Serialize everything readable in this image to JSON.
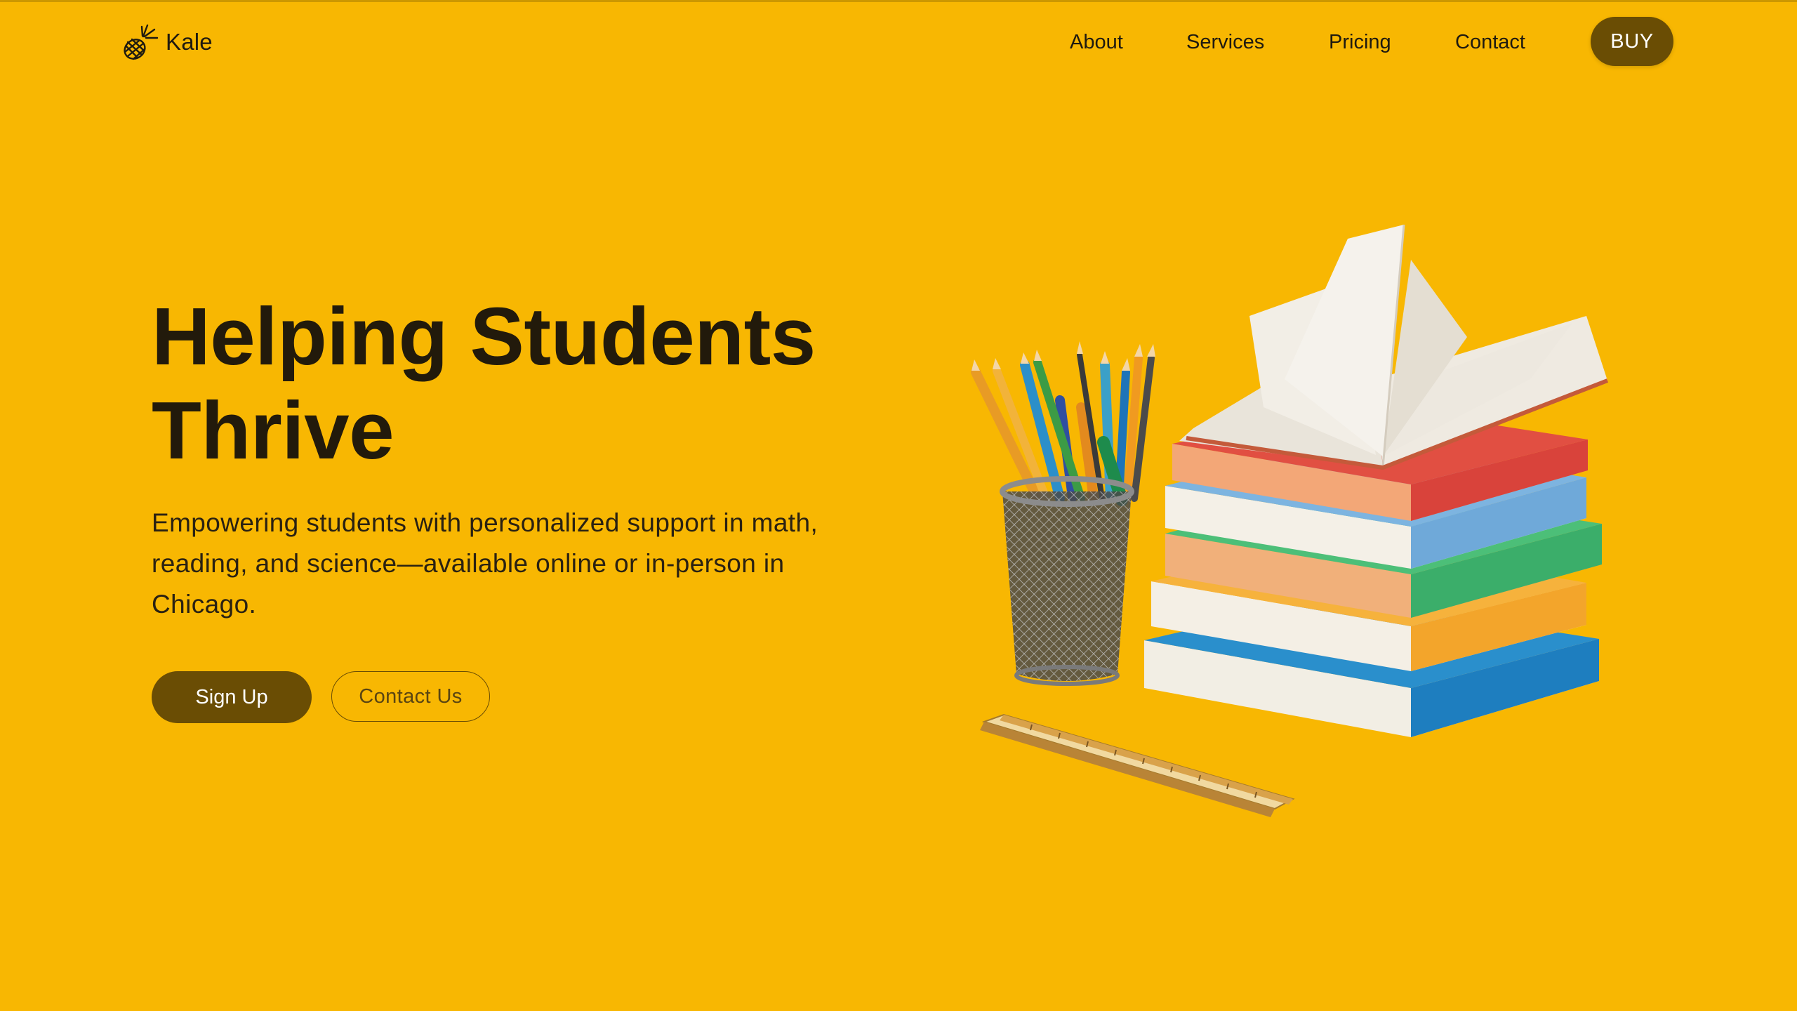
{
  "brand": {
    "name": "Kale",
    "logo_icon": "pineapple-icon"
  },
  "nav": {
    "links": [
      "About",
      "Services",
      "Pricing",
      "Contact"
    ],
    "buy_label": "BUY"
  },
  "hero": {
    "title_line1": "Helping Students",
    "title_line2": "Thrive",
    "subtitle": "Empowering students with personalized support in math, reading, and science—available online or in-person in Chicago.",
    "primary_cta": "Sign Up",
    "secondary_cta": "Contact Us"
  },
  "illustration": {
    "name": "books-and-pencils-illustration"
  },
  "colors": {
    "background": "#F8B702",
    "accent_dark": "#6A4D04",
    "text": "#221A0B"
  }
}
